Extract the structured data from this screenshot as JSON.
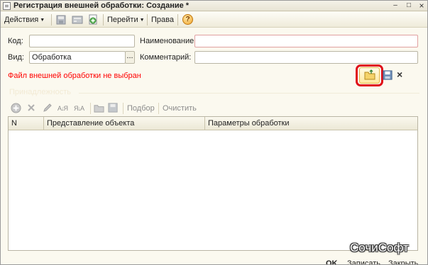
{
  "window": {
    "title": "Регистрация внешней обработки: Создание *",
    "minimize_glyph": "–",
    "maximize_glyph": "□",
    "close_glyph": "×"
  },
  "toolbar": {
    "actions_label": "Действия",
    "goto_label": "Перейти",
    "rights_label": "Права",
    "help_glyph": "?"
  },
  "form": {
    "code_label": "Код:",
    "code_value": "",
    "name_label": "Наименование:",
    "name_value": "",
    "kind_label": "Вид:",
    "kind_value": "Обработка",
    "kind_select_glyph": "...",
    "comment_label": "Комментарий:",
    "comment_value": "",
    "file_status": "Файл внешней обработки не выбран",
    "clear_file_glyph": "×"
  },
  "accessory": {
    "label": "Принадлежность",
    "select_label": "Подбор",
    "clear_label": "Очистить",
    "sort_asc_label": "А↓Я",
    "sort_desc_label": "Я↓А"
  },
  "table": {
    "columns": [
      "N",
      "Представление объекта",
      "Параметры обработки"
    ],
    "rows": []
  },
  "footer": {
    "ok_label": "OK",
    "save_label": "Записать",
    "close_label": "Закрыть"
  },
  "watermark": "СочиСофт",
  "colors": {
    "error": "#ff0000",
    "highlight": "#e0101a",
    "window_bg": "#fbf9ef"
  }
}
